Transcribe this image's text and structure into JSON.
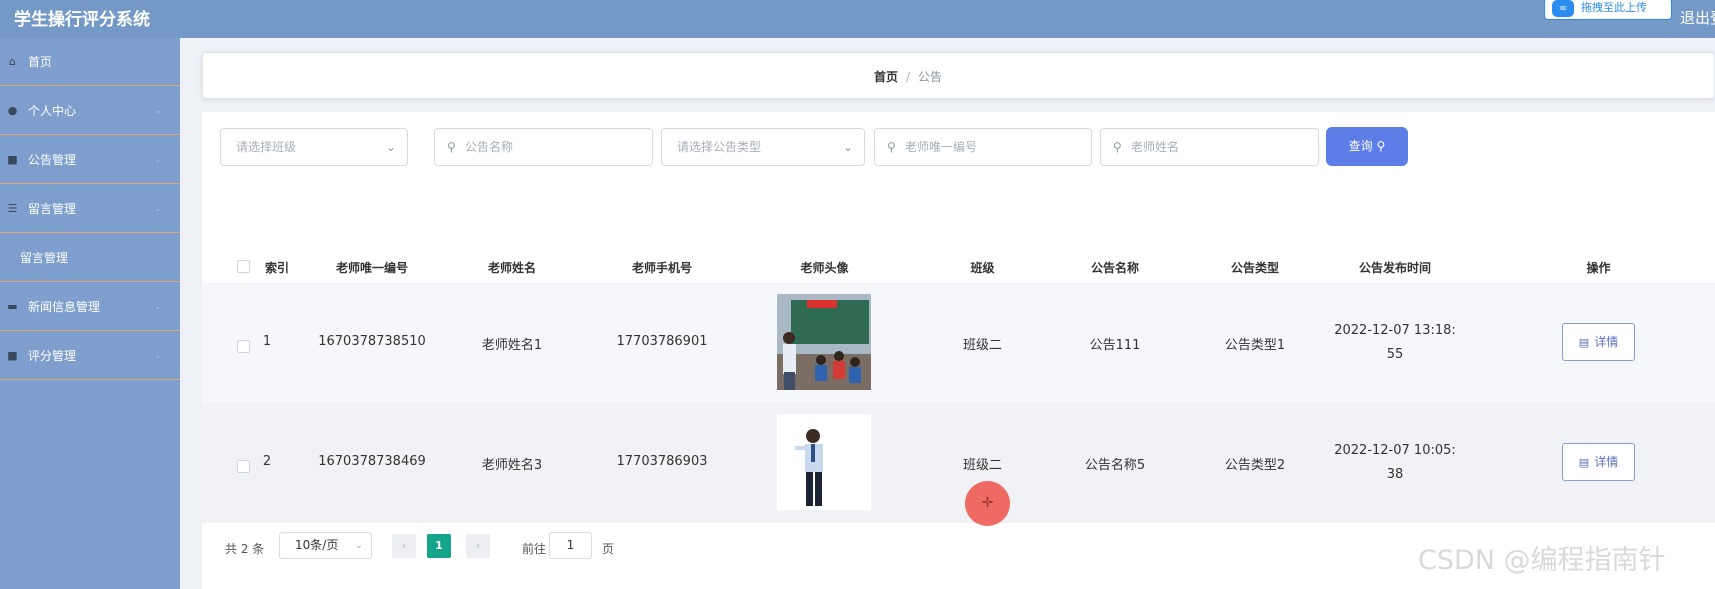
{
  "header": {
    "title": "学生操行评分系统",
    "upload_badge": "拖拽至此上传",
    "logout": "退出登"
  },
  "sidebar": {
    "items": [
      {
        "label": "首页",
        "icon": "home-icon",
        "glyph": "⌂"
      },
      {
        "label": "个人中心",
        "icon": "user-icon",
        "glyph": "●"
      },
      {
        "label": "公告管理",
        "icon": "notice-icon",
        "glyph": "■"
      },
      {
        "label": "留言管理",
        "icon": "menu-list-icon",
        "glyph": "☰"
      },
      {
        "label": "留言管理",
        "icon": ""
      },
      {
        "label": "新闻信息管理",
        "icon": "news-icon",
        "glyph": "▬"
      },
      {
        "label": "评分管理",
        "icon": "score-icon",
        "glyph": "■"
      }
    ],
    "chevron": "⌄"
  },
  "breadcrumb": {
    "home": "首页",
    "separator": "/",
    "current": "公告"
  },
  "search": {
    "class_select": "请选择班级",
    "notice_name": "公告名称",
    "notice_type_select": "请选择公告类型",
    "teacher_id": "老师唯一编号",
    "teacher_name": "老师姓名",
    "query_label": "查询",
    "search_glyph": "⚲",
    "arrow_glyph": "⌄"
  },
  "table": {
    "headers": [
      "索引",
      "老师唯一编号",
      "老师姓名",
      "老师手机号",
      "老师头像",
      "班级",
      "公告名称",
      "公告类型",
      "公告发布时间",
      "操作"
    ],
    "rows": [
      {
        "index": "1",
        "teacher_id": "1670378738510",
        "teacher_name": "老师姓名1",
        "phone": "17703786901",
        "class": "班级二",
        "notice_name": "公告111",
        "notice_type": "公告类型1",
        "time_line1": "2022-12-07 13:18:",
        "time_line2": "55",
        "action": "详情"
      },
      {
        "index": "2",
        "teacher_id": "1670378738469",
        "teacher_name": "老师姓名3",
        "phone": "17703786903",
        "class": "班级二",
        "notice_name": "公告名称5",
        "notice_type": "公告类型2",
        "time_line1": "2022-12-07 10:05:",
        "time_line2": "38",
        "action": "详情"
      }
    ]
  },
  "pagination": {
    "total": "共 2 条",
    "page_size": "10条/页",
    "prev": "‹",
    "current_page": "1",
    "next": "›",
    "goto_label": "前往",
    "goto_value": "1",
    "page_unit": "页"
  },
  "cursor_glyph": "✛",
  "watermark": "CSDN @编程指南针"
}
